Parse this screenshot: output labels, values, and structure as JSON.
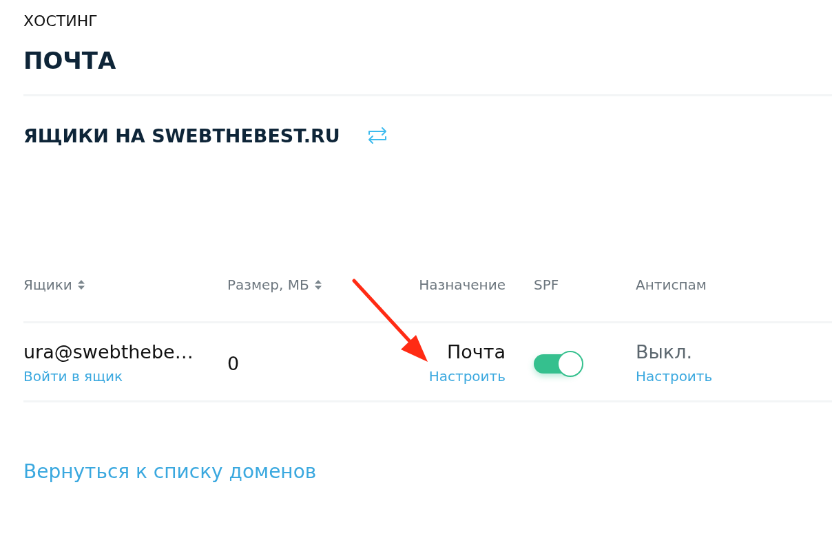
{
  "breadcrumb": "ХОСТИНГ",
  "page_title": "ПОЧТА",
  "section": {
    "title": "ЯЩИКИ НА SWEBTHEBEST.RU"
  },
  "table": {
    "columns": [
      {
        "label": "Ящики",
        "sortable": true
      },
      {
        "label": "Размер, МБ",
        "sortable": true
      },
      {
        "label": "Назначение",
        "sortable": false
      },
      {
        "label": "SPF",
        "sortable": false
      },
      {
        "label": "Антиспам",
        "sortable": false
      }
    ],
    "rows": [
      {
        "mailbox": "ura@swebthebe…",
        "mailbox_link": "Войти в ящик",
        "size": "0",
        "purpose": "Почта",
        "purpose_link": "Настроить",
        "spf_on": true,
        "antispam": "Выкл.",
        "antispam_link": "Настроить"
      }
    ]
  },
  "back_link": "Вернуться к списку доменов"
}
